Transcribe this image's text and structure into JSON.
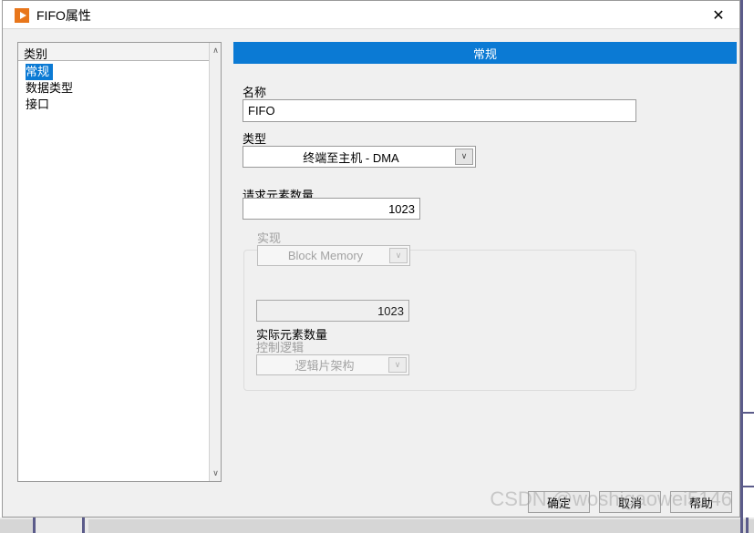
{
  "window": {
    "title": "FIFO属性",
    "icon": "labview-play-icon",
    "close_label": "✕"
  },
  "sidebar": {
    "header": "类别",
    "items": [
      {
        "label": "常规",
        "selected": true
      },
      {
        "label": "数据类型",
        "selected": false
      },
      {
        "label": "接口",
        "selected": false
      }
    ],
    "scroll_up": "∧",
    "scroll_down": "∨"
  },
  "content": {
    "banner": "常规",
    "fields": {
      "name_label": "名称",
      "name_value": "FIFO",
      "type_label": "类型",
      "type_value": "终端至主机 - DMA",
      "requested_label": "请求元素数量",
      "requested_value": "1023",
      "implementation_label": "实现",
      "implementation_value": "Block Memory",
      "actual_label": "实际元素数量",
      "actual_value": "1023",
      "control_logic_label": "控制逻辑",
      "control_logic_value": "逻辑片架构"
    },
    "dropdown_glyph": "∨"
  },
  "footer": {
    "ok": "确定",
    "cancel": "取消",
    "help": "帮助"
  },
  "watermark": "CSDN @woshigaowei5146",
  "colors": {
    "accent": "#0b7ad4",
    "icon_orange": "#e8761b",
    "dialog_bg": "#f0f0f0"
  }
}
